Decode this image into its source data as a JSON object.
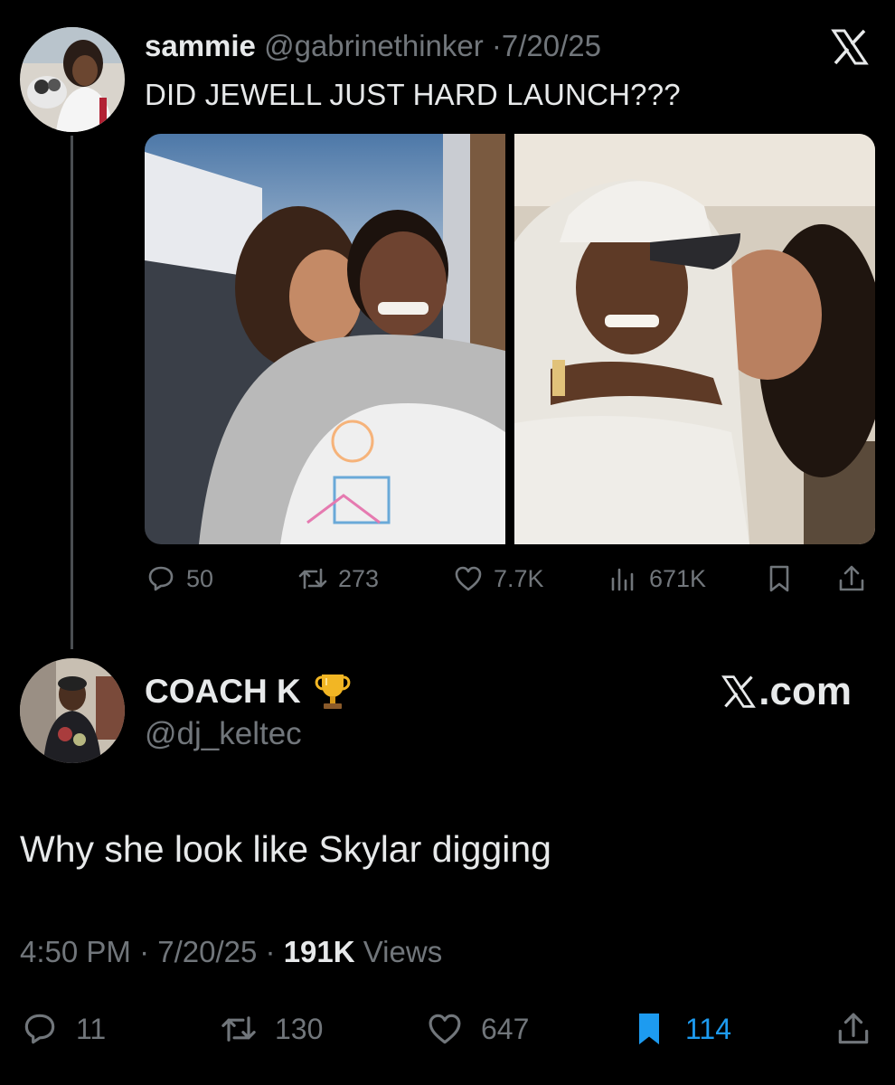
{
  "quoted_tweet": {
    "name": "sammie",
    "handle": "@gabrinethinker",
    "separator": "·",
    "date": "7/20/25",
    "text": "DID JEWELL JUST HARD LAUNCH???",
    "actions": {
      "replies": "50",
      "retweets": "273",
      "likes": "7.7K",
      "views": "671K"
    },
    "icons": [
      "reply-icon",
      "retweet-icon",
      "like-icon",
      "views-icon",
      "bookmark-icon",
      "share-icon"
    ]
  },
  "reply_tweet": {
    "name": "COACH K",
    "name_emoji": "trophy",
    "handle": "@dj_keltec",
    "source_label": ".com",
    "text": "Why she look like Skylar digging",
    "meta": {
      "time": "4:50 PM",
      "separator": "·",
      "date": "7/20/25",
      "views_count": "191K",
      "views_label": "Views"
    },
    "actions": {
      "replies": "11",
      "retweets": "130",
      "likes": "647",
      "bookmarks": "114"
    }
  },
  "colors": {
    "background": "#000000",
    "primary_text": "#e7e9ea",
    "secondary_text": "#71767b",
    "accent": "#1d9bf0",
    "thread_line": "#4a4e52"
  }
}
